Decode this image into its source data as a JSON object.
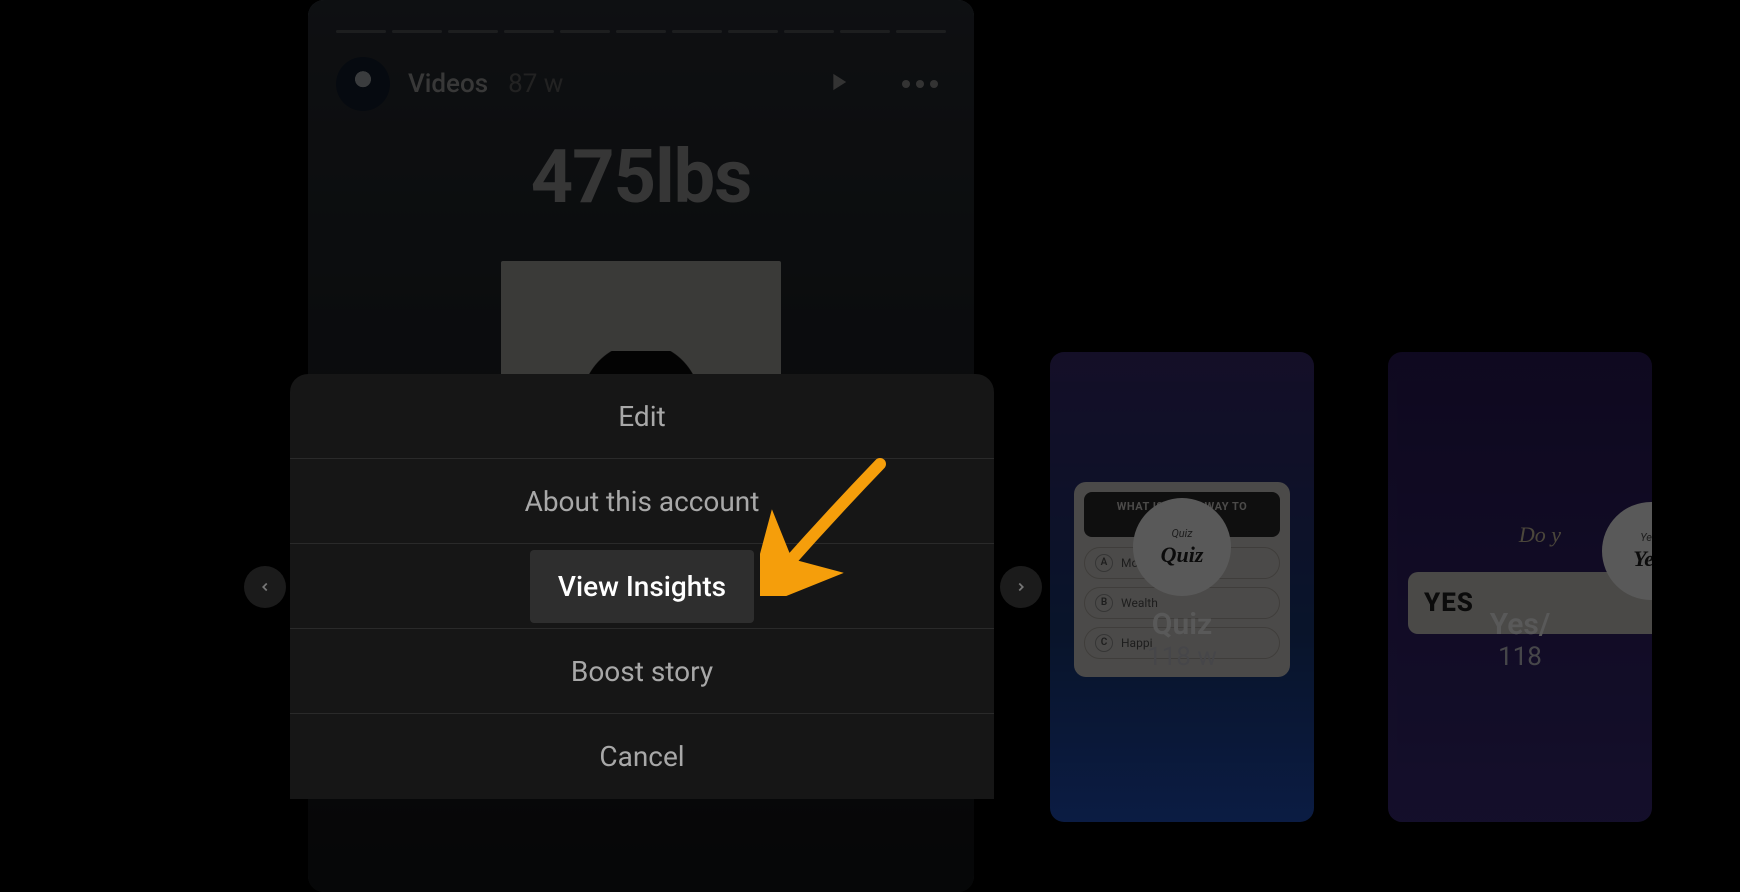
{
  "story": {
    "title": "Videos",
    "age": "87 w",
    "content_text": "475lbs"
  },
  "progress": {
    "segments": 11
  },
  "menu": {
    "items": [
      {
        "label": "Edit"
      },
      {
        "label": "About this account"
      },
      {
        "label": "View Insights",
        "highlighted": true
      },
      {
        "label": "Boost story"
      },
      {
        "label": "Cancel"
      }
    ]
  },
  "thumbs": [
    {
      "title": "Quiz",
      "age": "118 w",
      "badge_small": "Quiz",
      "badge_big": "Quiz",
      "question_line1": "WHAT IS",
      "question_line2": "WAY TO",
      "options": [
        {
          "letter": "A",
          "text": "Mo"
        },
        {
          "letter": "B",
          "text": "Wealth"
        },
        {
          "letter": "C",
          "text": "Happi"
        }
      ]
    },
    {
      "title": "Yes/",
      "age": "118",
      "do_you": "Do y",
      "yes_label": "YES",
      "badge_small": "Yes/",
      "badge_big": "Yes/"
    }
  ]
}
